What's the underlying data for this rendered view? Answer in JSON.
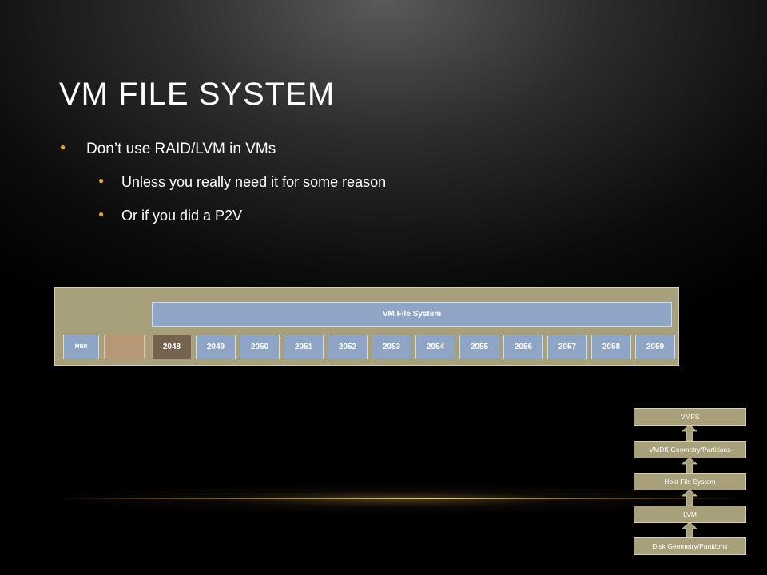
{
  "slide": {
    "title": "VM FILE SYSTEM",
    "bullets": [
      {
        "text": "Don’t use RAID/LVM in VMs"
      },
      {
        "text": "Unless you really need it for some reason"
      },
      {
        "text": "Or if you did a P2V"
      }
    ],
    "accent_color": "#e3a92b"
  },
  "disk_diagram": {
    "vmfs_label": "VM File System",
    "mbr_label": "MBR",
    "sectors": [
      "2048",
      "2049",
      "2050",
      "2051",
      "2052",
      "2053",
      "2054",
      "2055",
      "2056",
      "2057",
      "2058",
      "2059"
    ],
    "colors": {
      "frame": "#a8a07a",
      "block": "#8ea5c5",
      "first_sector": "#75624f",
      "gap": "#b79874"
    }
  },
  "layer_stack": {
    "layers": [
      "VMFS",
      "VMDK Geometry/Partitions",
      "Host File System",
      "LVM",
      "Disk Geometry/Partitions"
    ]
  }
}
